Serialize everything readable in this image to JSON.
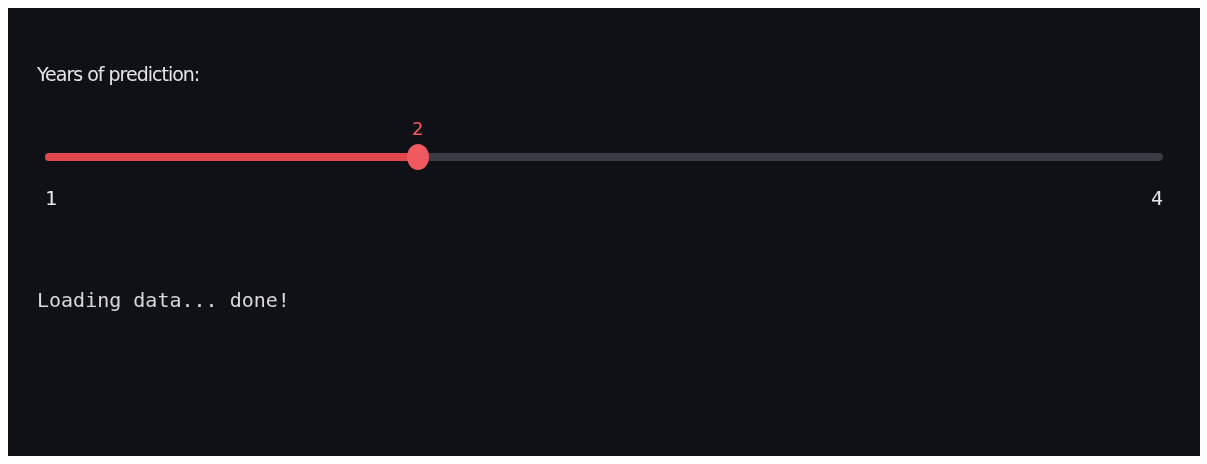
{
  "slider": {
    "label": "Years of prediction:",
    "value": "2",
    "level": 0.3333,
    "min": "1",
    "max": "4"
  },
  "status_text": "Loading data... done!"
}
